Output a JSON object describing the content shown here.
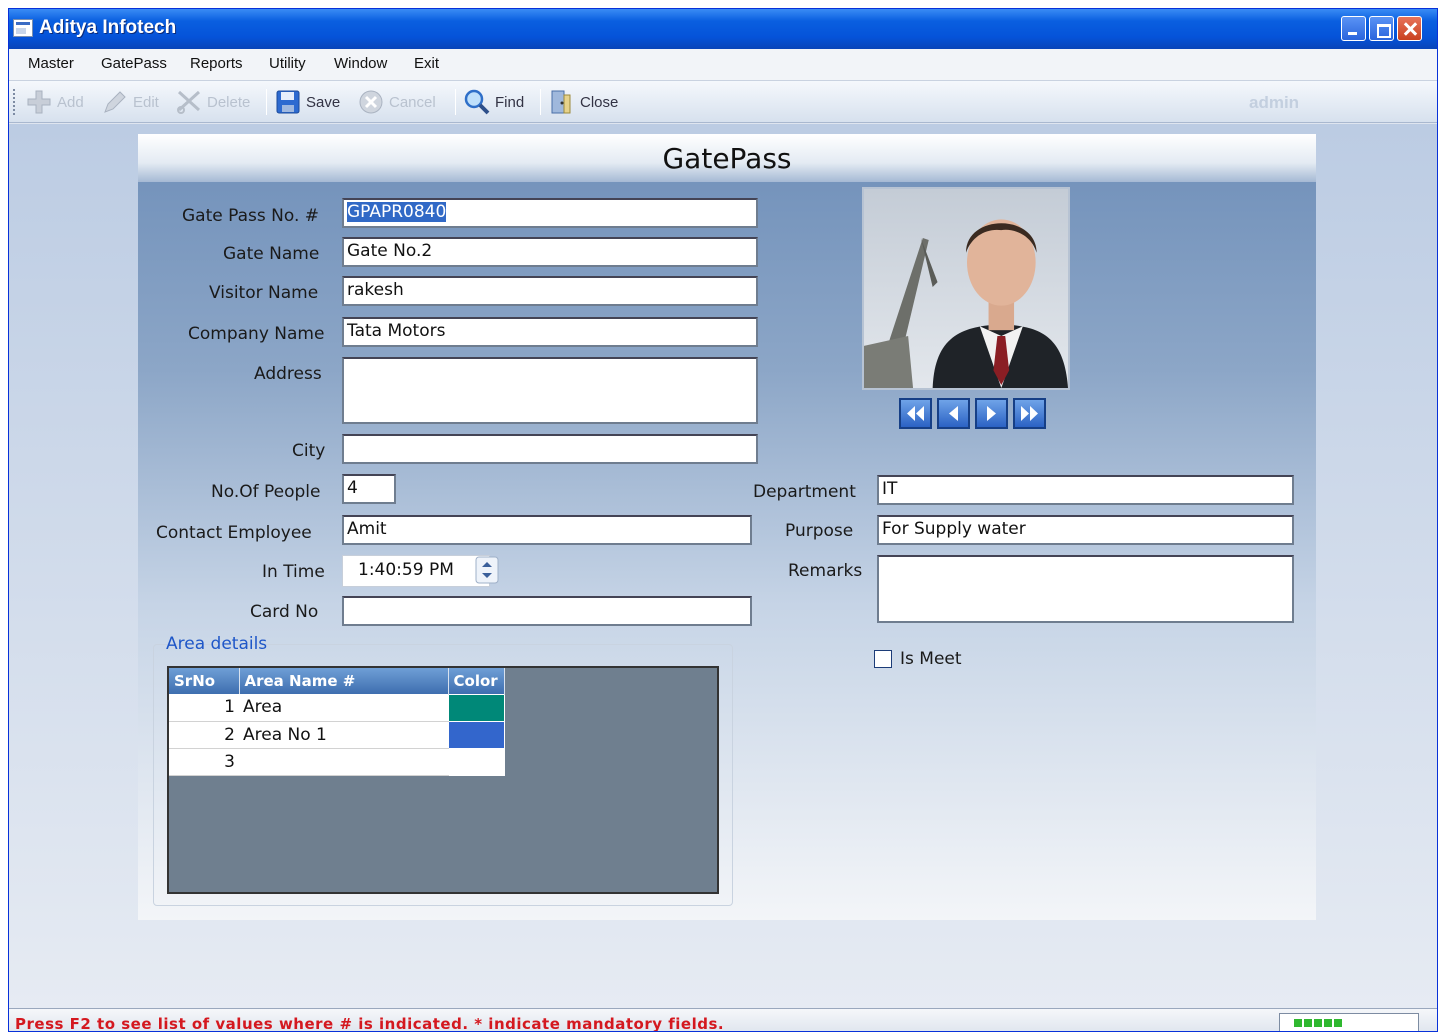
{
  "window": {
    "title": "Aditya Infotech"
  },
  "menu": [
    "Master",
    "GatePass",
    "Reports",
    "Utility",
    "Window",
    "Exit"
  ],
  "toolbar": {
    "add": "Add",
    "edit": "Edit",
    "delete": "Delete",
    "save": "Save",
    "cancel": "Cancel",
    "find": "Find",
    "close": "Close",
    "user": "admin"
  },
  "form": {
    "title": "GatePass",
    "labels": {
      "gate_pass_no": "Gate Pass No. #",
      "gate_name": "Gate Name",
      "visitor_name": "Visitor Name",
      "company_name": "Company Name",
      "address": "Address",
      "city": "City",
      "no_of_people": "No.Of People",
      "contact_employee": "Contact Employee",
      "in_time": "In Time",
      "card_no": "Card No",
      "department": "Department",
      "purpose": "Purpose",
      "remarks": "Remarks",
      "is_meet": "Is Meet"
    },
    "values": {
      "gate_pass_no": "GPAPR0840",
      "gate_name": "Gate No.2",
      "visitor_name": "rakesh",
      "company_name": "Tata Motors",
      "address": "",
      "city": "",
      "no_of_people": "4",
      "contact_employee": "Amit",
      "in_time": "1:40:59 PM",
      "card_no": "",
      "department": "IT",
      "purpose": "For Supply water",
      "remarks": "",
      "is_meet": false
    },
    "area_details": {
      "legend": "Area details",
      "columns": [
        "SrNo",
        "Area Name #",
        "Color"
      ],
      "rows": [
        {
          "srno": "1",
          "area_name": "Area",
          "color": "#008878"
        },
        {
          "srno": "2",
          "area_name": "Area No 1",
          "color": "#3366cc"
        },
        {
          "srno": "3",
          "area_name": "",
          "color": ""
        }
      ]
    }
  },
  "status": {
    "message": "Press F2 to see list of values where # is indicated.  * indicate mandatory fields."
  },
  "colors": {
    "titlebar": "#0553d9",
    "status_text": "#d4181f",
    "grid_header": "#4f7fc0",
    "selection": "#3169c6"
  }
}
